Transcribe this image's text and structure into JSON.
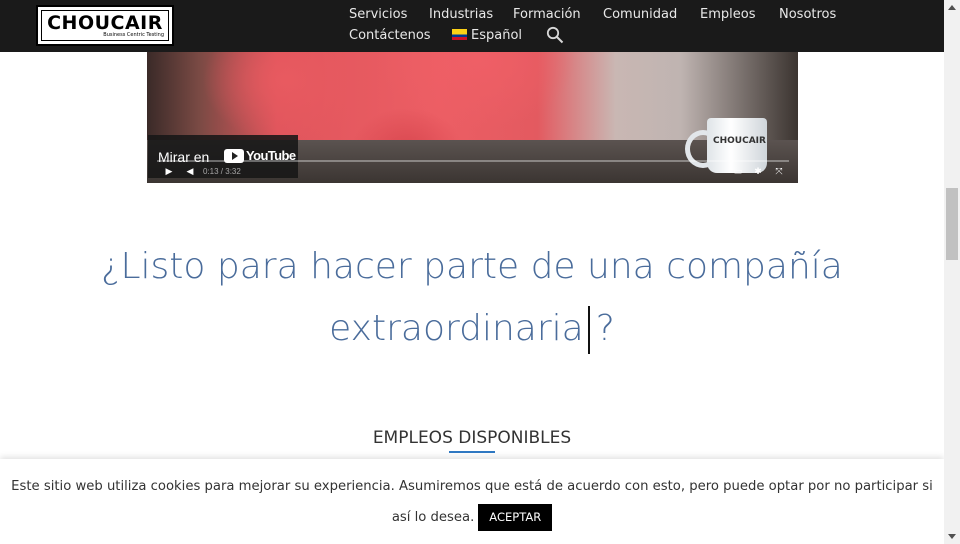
{
  "brand": {
    "name": "CHOUCAIR",
    "tagline": "Business Centric Testing"
  },
  "nav": {
    "items": [
      "Servicios",
      "Industrias",
      "Formación",
      "Comunidad",
      "Empleos",
      "Nosotros",
      "Contáctenos"
    ],
    "language": "Español",
    "search_icon": "search-icon"
  },
  "video": {
    "watch_label": "Mirar en",
    "platform": "YouTube",
    "mug_text": "CHOUCAIR",
    "time": "0:13 / 3:32"
  },
  "headline": {
    "line1": "¿Listo para hacer parte de una compañía",
    "line2_word": "extraordinaria",
    "line2_end": "?"
  },
  "section": {
    "title": "EMPLEOS DISPONIBLES"
  },
  "cookie": {
    "text": "Este sitio web utiliza cookies para mejorar su experiencia. Asumiremos que está de acuerdo con esto, pero puede optar por no participar si así lo desea.",
    "accept_label": "ACEPTAR"
  },
  "colors": {
    "nav_bg": "#1a1a1a",
    "headline": "#4a6c9b",
    "accent": "#2f78c3"
  }
}
